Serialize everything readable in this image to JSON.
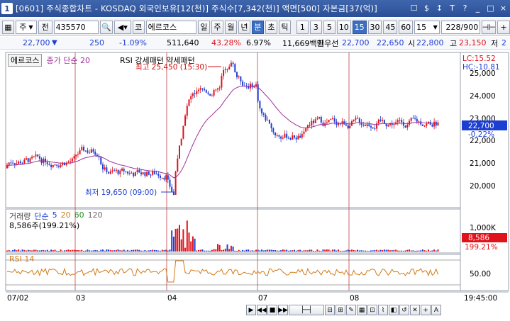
{
  "window": {
    "number": "1",
    "title": "[0601] 주식종합차트 - KOSDAQ 외국인보유[12(천)] 주식수[7,342(천)] 액면[500] 자본금[37(억)]",
    "buttons": [
      "☐",
      "$",
      "↕",
      "T",
      "?",
      "_",
      "□",
      "×"
    ]
  },
  "toolbar": {
    "market": "주",
    "market_type": "전",
    "code": "435570",
    "exchange": "코",
    "name": "에르코스",
    "periods": [
      "일",
      "주",
      "월",
      "년",
      "분",
      "초",
      "틱"
    ],
    "active_period": "분",
    "intervals": [
      "1",
      "3",
      "5",
      "10",
      "15",
      "30",
      "45",
      "60"
    ],
    "active_interval": "15",
    "interval_value": "15",
    "count": "228/900"
  },
  "price_bar": {
    "price": "22,700",
    "direction": "▼",
    "change": "250",
    "change_pct": "-1.09%",
    "volume": "511,640",
    "volume_pct": "43.28%",
    "turnover": "6.97%",
    "amount": "11,669백만",
    "label_prev": "최우선",
    "bid1": "22,700",
    "bid2": "22,650",
    "label_open": "시",
    "open": "22,800",
    "label_high": "고",
    "high": "23,150",
    "label_low": "저",
    "low": "2"
  },
  "chart": {
    "stock_name_tab": "에르코스",
    "ma_legend": "종가 단순 20",
    "indicator_title": "RSI 강세패턴  약세패턴",
    "max_label": "최고 25,450 (15:30)",
    "min_label": "최저 19,650 (09:00)",
    "lc_label": "LC:15.52",
    "hc_label": "HC:-10.81",
    "current_price": "22,700",
    "current_pct": "-0.22%",
    "y_ticks": [
      "25,000",
      "24,000",
      "23,000",
      "22,000",
      "21,000",
      "20,000"
    ],
    "volume_legend": {
      "title": "거래량",
      "type": "단순",
      "p1": "5",
      "p2": "20",
      "p3": "60",
      "p4": "120"
    },
    "volume_value": "8,586주(199.21%)",
    "volume_ticks": [
      "1,000K",
      "500K"
    ],
    "volume_current": "8,586",
    "volume_current_pct": "199.21%",
    "rsi_legend": "RSI 14",
    "rsi_tick": "50.00",
    "x_labels": [
      "07/02",
      "03",
      "04",
      "07",
      "08"
    ],
    "time_label": "19:45:00"
  },
  "colors": {
    "up": "#e0121b",
    "down": "#1d3fd1",
    "ma": "#a0309c",
    "separator": "#c0404a"
  }
}
